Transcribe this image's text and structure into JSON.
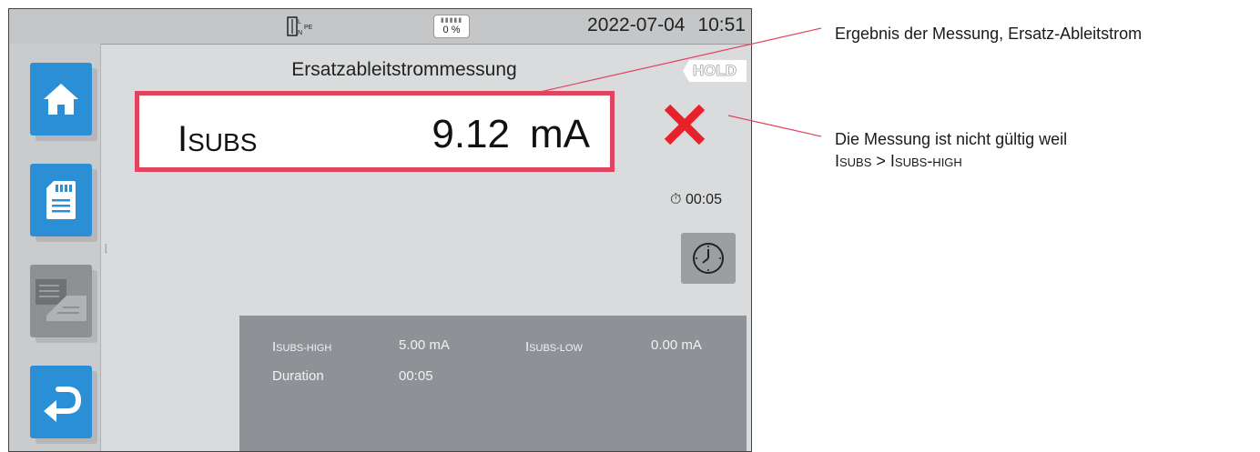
{
  "statusbar": {
    "connection_label": "L N PE",
    "battery_percent": "0 %",
    "date": "2022-07-04",
    "time": "10:51"
  },
  "screen": {
    "title": "Ersatzableitstrommessung",
    "hold_badge": "HOLD",
    "result": {
      "symbol": "I",
      "subscript": "SUBS",
      "value": "9.12",
      "unit": "mA",
      "valid": false
    },
    "timer": "00:05"
  },
  "sidebar": {
    "items": [
      {
        "name": "home",
        "icon": "home-icon"
      },
      {
        "name": "save",
        "icon": "sd-card-icon"
      },
      {
        "name": "records",
        "icon": "records-icon"
      },
      {
        "name": "back",
        "icon": "back-arrow-icon"
      }
    ]
  },
  "params": {
    "high_label": "I",
    "high_sub": "SUBS-HIGH",
    "high_value": "5.00 mA",
    "low_label": "I",
    "low_sub": "SUBS-LOW",
    "low_value": "0.00 mA",
    "duration_label": "Duration",
    "duration_value": "00:05"
  },
  "annotations": {
    "result_note": "Ergebnis der Messung, Ersatz-Ableitstrom",
    "invalid_note_line1": "Die Messung ist nicht gültig weil",
    "invalid_note_line2": "Isubs > Isubs-high"
  },
  "colors": {
    "accent_blue": "#2b8fd6",
    "result_border": "#e0445e",
    "cross_red": "#e8202a",
    "annotation_line": "#e0445e"
  }
}
